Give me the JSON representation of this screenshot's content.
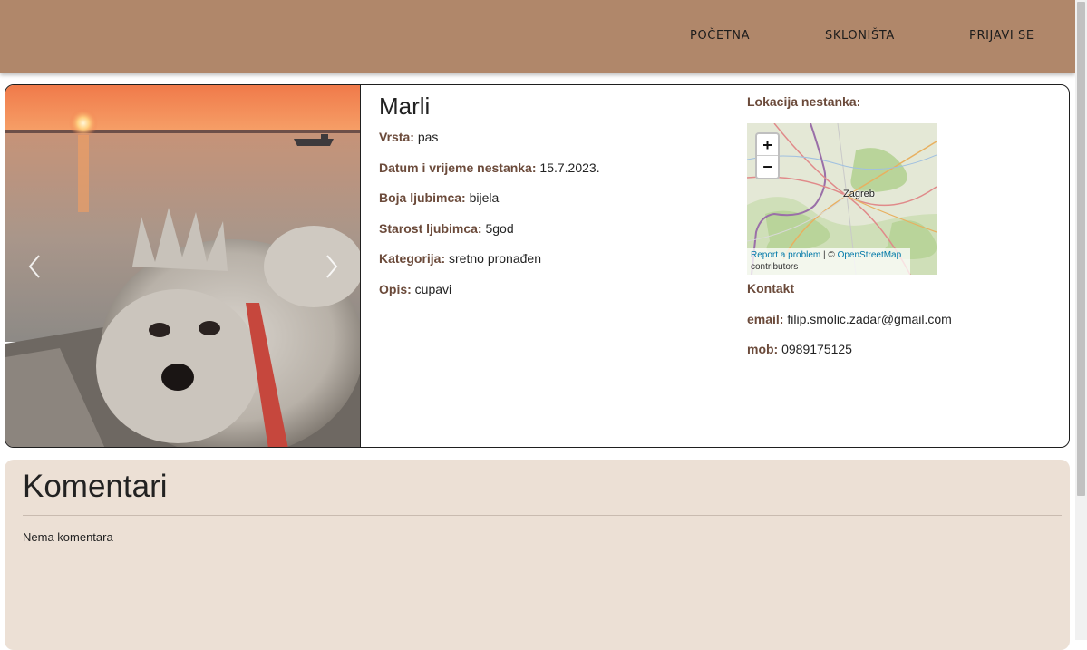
{
  "nav": {
    "home_label": "POČETNA",
    "shelters_label": "SKLONIŠTA",
    "login_label": "PRIJAVI SE"
  },
  "pet": {
    "name": "Marli",
    "fields": [
      {
        "label": "Vrsta:",
        "value": "pas"
      },
      {
        "label": "Datum i vrijeme nestanka:",
        "value": "15.7.2023."
      },
      {
        "label": "Boja ljubimca:",
        "value": "bijela"
      },
      {
        "label": "Starost ljubimca:",
        "value": "5god"
      },
      {
        "label": "Kategorija:",
        "value": "sretno pronađen"
      },
      {
        "label": "Opis:",
        "value": "cupavi"
      }
    ]
  },
  "location": {
    "title": "Lokacija nestanka:",
    "zoom_in": "+",
    "zoom_out": "−",
    "city": "Zagreb",
    "attribution_report": "Report a problem",
    "attribution_sep": " | © ",
    "attribution_osm": "OpenStreetMap",
    "attribution_contrib": "contributors"
  },
  "contact": {
    "title": "Kontakt",
    "email_label": "email:",
    "email": "filip.smolic.zadar@gmail.com",
    "mob_label": "mob:",
    "mob": "0989175125"
  },
  "comments": {
    "title": "Komentari",
    "empty": "Nema komentara"
  },
  "carousel": {
    "prev_icon": "chevron-left-icon",
    "next_icon": "chevron-right-icon"
  },
  "colors": {
    "navbar": "#b0876a",
    "label": "#6b4a3a",
    "comments_bg": "#ece0d5"
  }
}
